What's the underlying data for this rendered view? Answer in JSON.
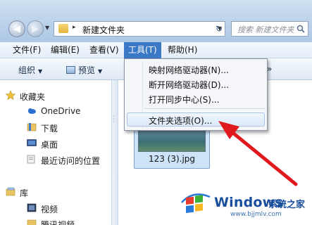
{
  "address_bar": {
    "path_separator": "▸",
    "current_folder": "新建文件夹",
    "search_placeholder": "搜索 新建文件夹"
  },
  "menubar": {
    "items": [
      {
        "label": "文件(F)"
      },
      {
        "label": "编辑(E)"
      },
      {
        "label": "查看(V)"
      },
      {
        "label": "工具(T)",
        "active": true
      },
      {
        "label": "帮助(H)"
      }
    ]
  },
  "toolbar": {
    "organize_label": "组织",
    "preview_label": "预览",
    "more_label": "»"
  },
  "navpane": {
    "favorites_label": "收藏夹",
    "items": [
      {
        "label": "OneDrive",
        "icon": "cloud-icon"
      },
      {
        "label": "下载",
        "icon": "download-folder-icon"
      },
      {
        "label": "桌面",
        "icon": "desktop-icon"
      },
      {
        "label": "最近访问的位置",
        "icon": "recent-places-icon"
      }
    ],
    "libraries_label": "库",
    "library_items": [
      {
        "label": "视频",
        "icon": "video-library-icon"
      },
      {
        "label": "腾讯视频",
        "icon": "folder-icon"
      }
    ]
  },
  "content": {
    "file_name": "123 (3).jpg"
  },
  "tools_menu": {
    "items": [
      {
        "label": "映射网络驱动器(N)..."
      },
      {
        "label": "断开网络驱动器(D)..."
      },
      {
        "label": "打开同步中心(S)..."
      },
      {
        "label": "文件夹选项(O)...",
        "highlighted": true
      }
    ]
  },
  "watermark": {
    "brand": "Windows",
    "brand_cn": "系统之家",
    "url": "www.bjjmlv.com"
  },
  "colors": {
    "menu_active": "#3b78c6",
    "annotation_arrow": "#e0191f",
    "watermark_blue": "#1a4f9e"
  }
}
